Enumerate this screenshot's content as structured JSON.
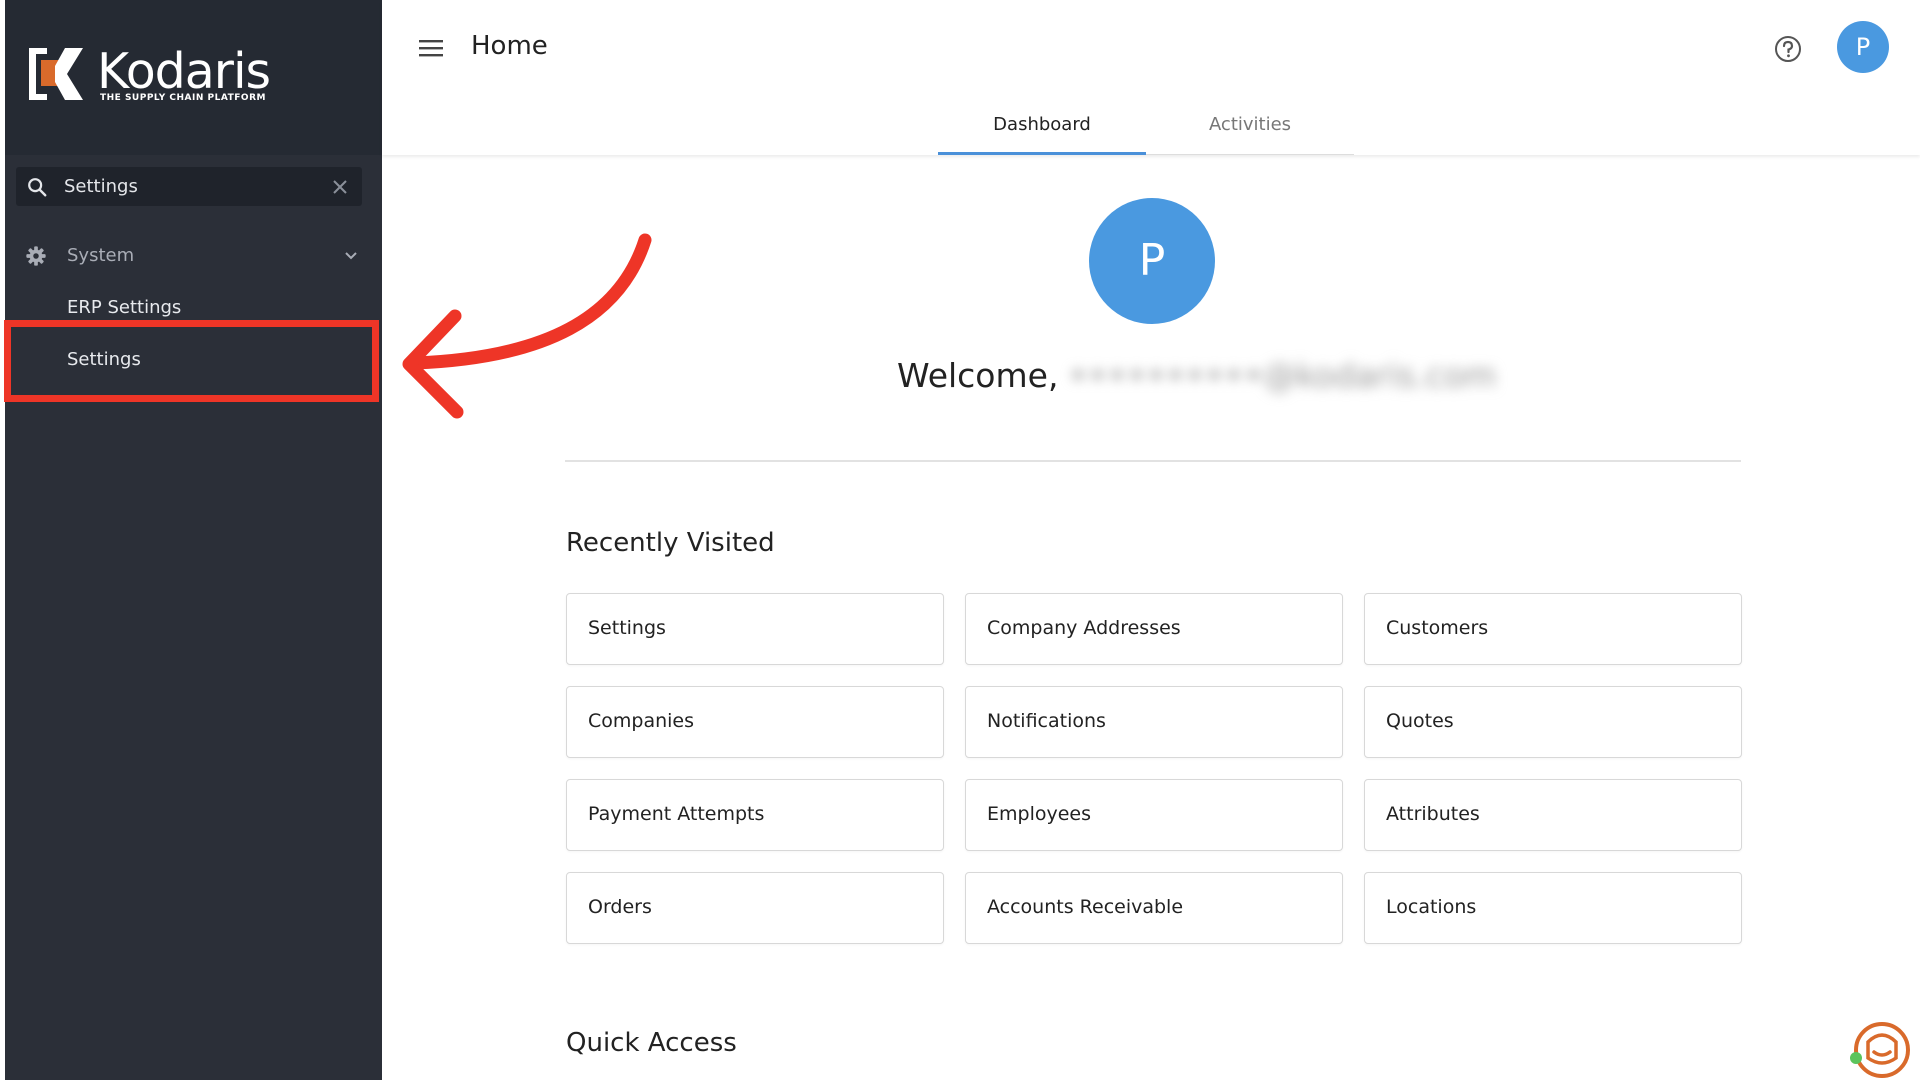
{
  "brand": {
    "name": "Kodaris",
    "tagline": "THE SUPPLY CHAIN PLATFORM",
    "accent": "#d96a2b"
  },
  "sidebar": {
    "search": {
      "value": "Settings",
      "placeholder": "Search"
    },
    "group": {
      "label": "System",
      "icon": "gear-icon"
    },
    "items": [
      {
        "label": "ERP Settings"
      },
      {
        "label": "Settings"
      }
    ]
  },
  "header": {
    "title": "Home",
    "avatar_initial": "P",
    "tabs": [
      {
        "label": "Dashboard",
        "active": true
      },
      {
        "label": "Activities",
        "active": false
      }
    ]
  },
  "main": {
    "avatar_initial": "P",
    "welcome_prefix": "Welcome,",
    "welcome_user": "••••••••••@kodaris.com",
    "recent_title": "Recently Visited",
    "recent": [
      "Settings",
      "Company Addresses",
      "Customers",
      "Companies",
      "Notifications",
      "Quotes",
      "Payment Attempts",
      "Employees",
      "Attributes",
      "Orders",
      "Accounts Receivable",
      "Locations"
    ],
    "quick_title": "Quick Access"
  },
  "colors": {
    "sidebar_bg": "#2b2f38",
    "avatar_blue": "#4a99e0",
    "annotation_red": "#ee3527",
    "tab_underline": "#4a90d9"
  }
}
